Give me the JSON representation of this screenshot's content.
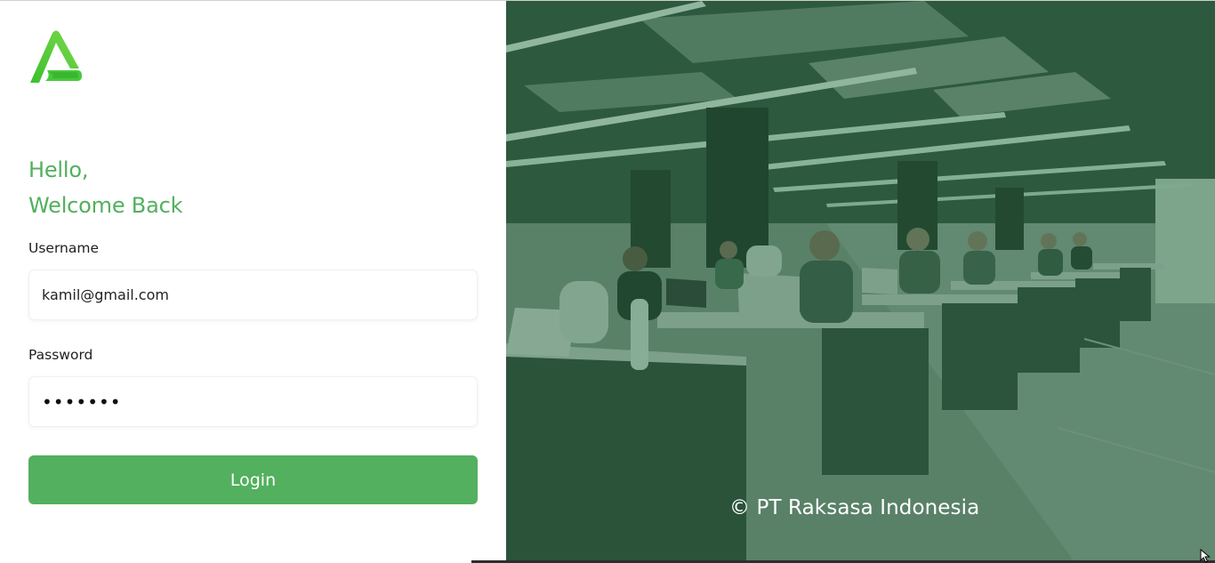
{
  "greeting": {
    "line1": "Hello,",
    "line2": "Welcome Back"
  },
  "form": {
    "username_label": "Username",
    "username_value": "kamil@gmail.com",
    "password_label": "Password",
    "password_value": "•••••••",
    "login_label": "Login"
  },
  "footer": {
    "copyright": "© PT Raksasa Indonesia"
  },
  "icons": {
    "logo": "raksasa-logo-icon",
    "cursor": "mouse-pointer-icon"
  },
  "colors": {
    "accent": "#52b05e",
    "overlay": "#166034"
  }
}
